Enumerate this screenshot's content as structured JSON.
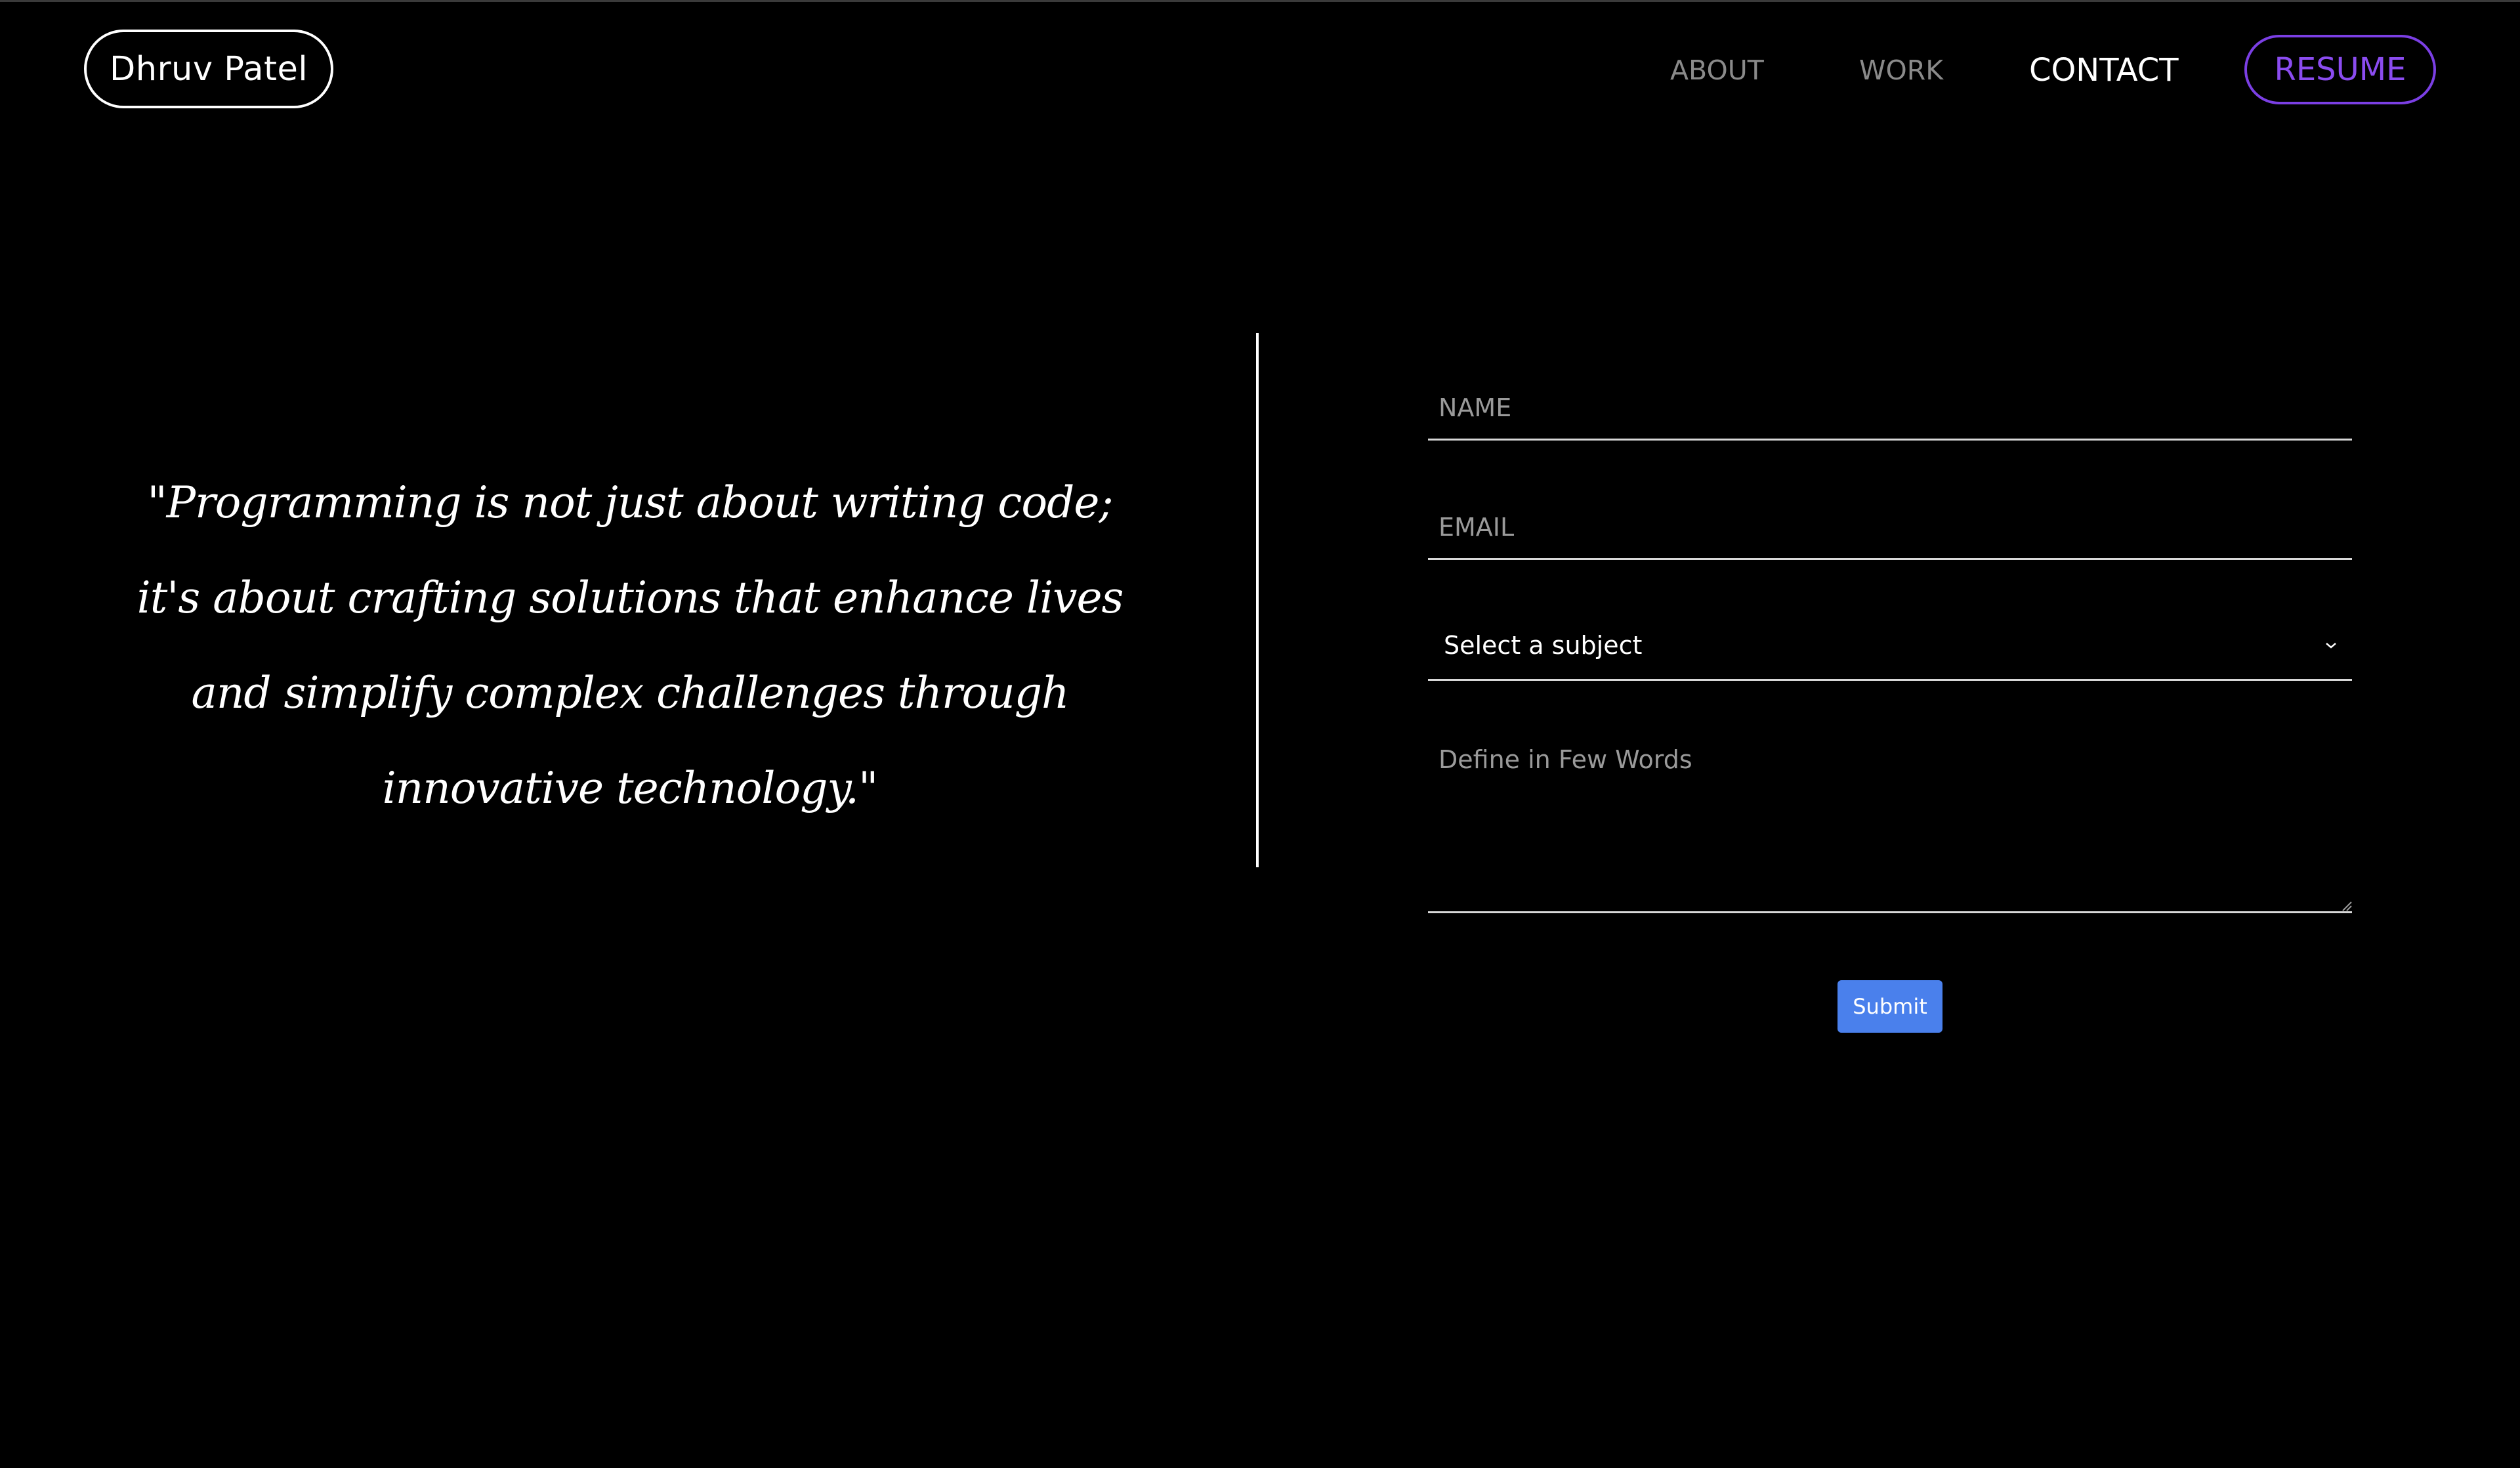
{
  "header": {
    "brand": "Dhruv Patel",
    "nav": {
      "about": "ABOUT",
      "work": "WORK",
      "contact": "CONTACT"
    },
    "resume_label": "RESUME"
  },
  "quote": {
    "text": "\"Programming is not just about writing code; it's about crafting solutions that enhance lives and simplify complex challenges through innovative technology.\""
  },
  "form": {
    "name_placeholder": "NAME",
    "email_placeholder": "EMAIL",
    "subject_selected": "Select a subject",
    "message_placeholder": "Define in Few Words",
    "submit_label": "Submit"
  },
  "colors": {
    "background": "#000000",
    "accent_purple": "#8b4cf0",
    "submit_blue": "#4a80ec",
    "muted_nav": "#8a8a8a"
  },
  "icons": {
    "subject_dropdown": "chevron-down-icon",
    "textarea_resize": "resize-grip-icon"
  }
}
